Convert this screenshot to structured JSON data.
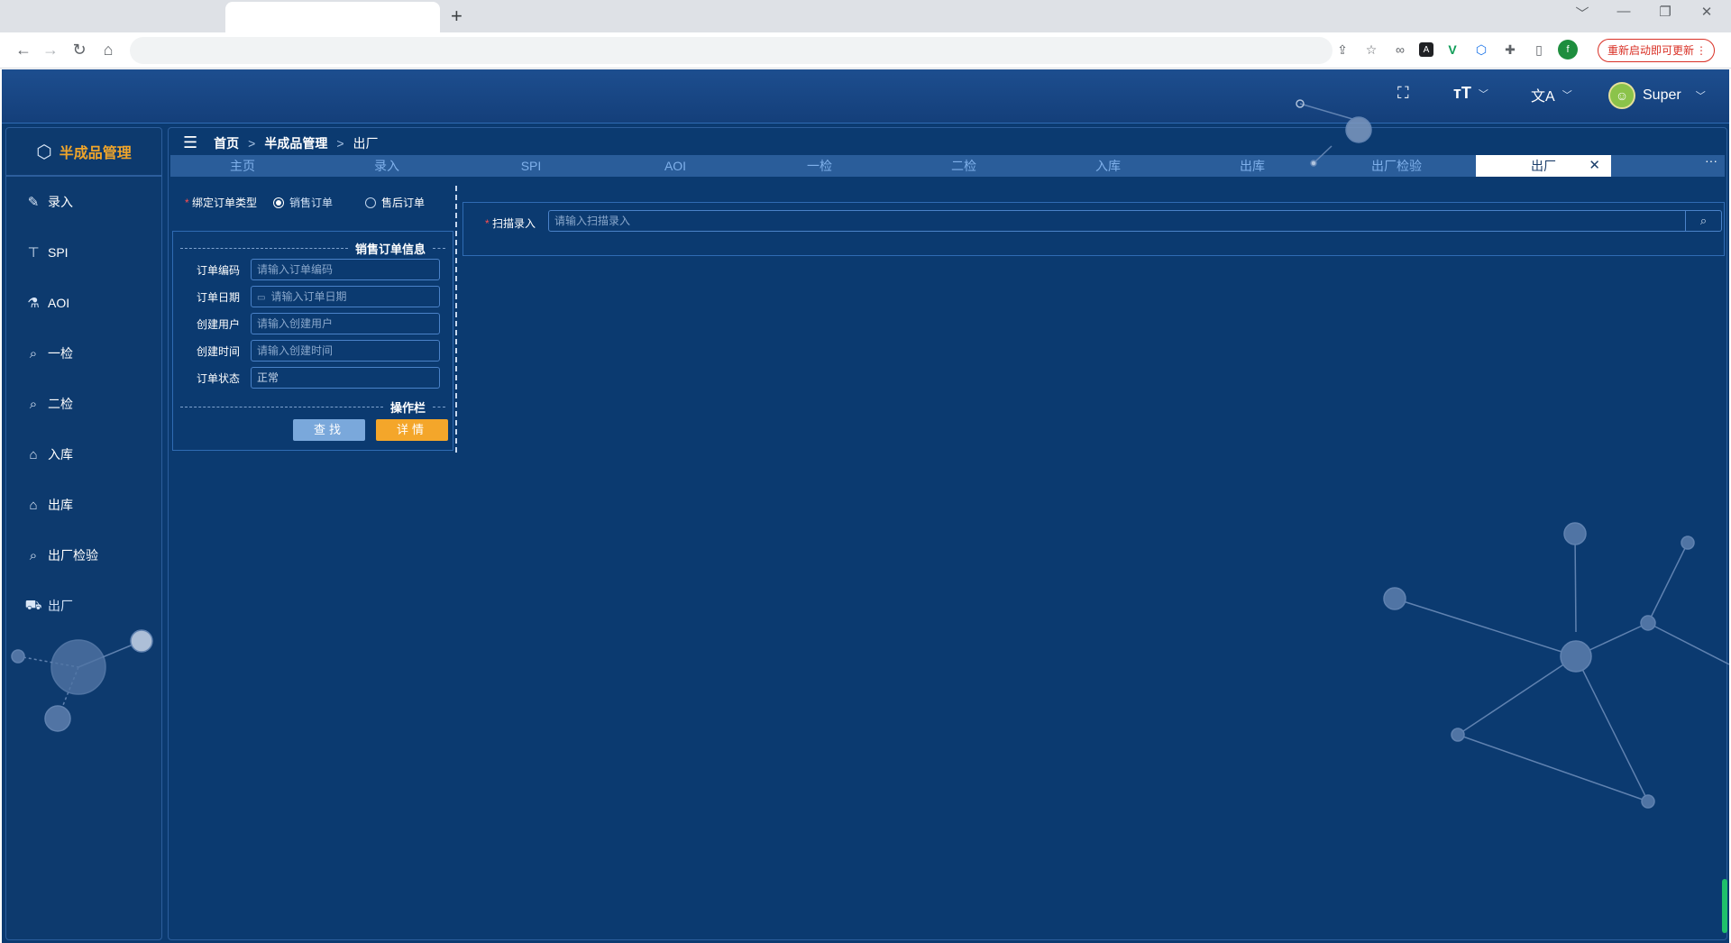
{
  "browser": {
    "new_tab_label": "+",
    "window_controls": [
      "﹀",
      "—",
      "❐",
      "✕"
    ],
    "update_button": "重新启动即可更新",
    "update_menu": "⋮",
    "profile_initial": "f",
    "extension_icons": [
      "share-icon",
      "star-icon",
      "link-icon",
      "font-icon",
      "vue-icon",
      "box-icon",
      "puzzle-icon",
      "sidepanel-icon"
    ]
  },
  "header": {
    "fullscreen_icon": "⛶",
    "font_size_icon": "тT",
    "translate_icon": "文A",
    "username": "Super"
  },
  "sidebar": {
    "title": "半成品管理",
    "items": [
      {
        "label": "录入",
        "icon": "📝"
      },
      {
        "label": "SPI",
        "icon": "⚲"
      },
      {
        "label": "AOI",
        "icon": "⚗"
      },
      {
        "label": "一检",
        "icon": "🔍"
      },
      {
        "label": "二检",
        "icon": "🔍"
      },
      {
        "label": "入库",
        "icon": "⌂"
      },
      {
        "label": "出库",
        "icon": "⌂"
      },
      {
        "label": "出厂检验",
        "icon": "🔍"
      },
      {
        "label": "出厂",
        "icon": "⛟"
      }
    ]
  },
  "breadcrumb": {
    "home": "首页",
    "level1": "半成品管理",
    "level2": "出厂",
    "separator": ">"
  },
  "tabs": {
    "items": [
      "主页",
      "录入",
      "SPI",
      "AOI",
      "一检",
      "二检",
      "入库",
      "出库",
      "出厂检验",
      "出厂"
    ],
    "active_index": 9,
    "close_label": "✕",
    "more_label": "···"
  },
  "order_type": {
    "label": "绑定订单类型",
    "required_mark": "*",
    "options": [
      "销售订单",
      "售后订单"
    ],
    "selected": "销售订单"
  },
  "order_info": {
    "section_title": "销售订单信息",
    "fields": [
      {
        "label": "订单编码",
        "placeholder": "请输入订单编码",
        "value": ""
      },
      {
        "label": "订单日期",
        "placeholder": "请输入订单日期",
        "value": ""
      },
      {
        "label": "创建用户",
        "placeholder": "请输入创建用户",
        "value": ""
      },
      {
        "label": "创建时间",
        "placeholder": "请输入创建时间",
        "value": ""
      },
      {
        "label": "订单状态",
        "placeholder": "",
        "value": "正常"
      }
    ],
    "actions_title": "操作栏",
    "search_button": "查找",
    "detail_button": "详情"
  },
  "scan": {
    "required_mark": "*",
    "label": "扫描录入",
    "placeholder": "请输入扫描录入",
    "search_icon": "⌕"
  }
}
